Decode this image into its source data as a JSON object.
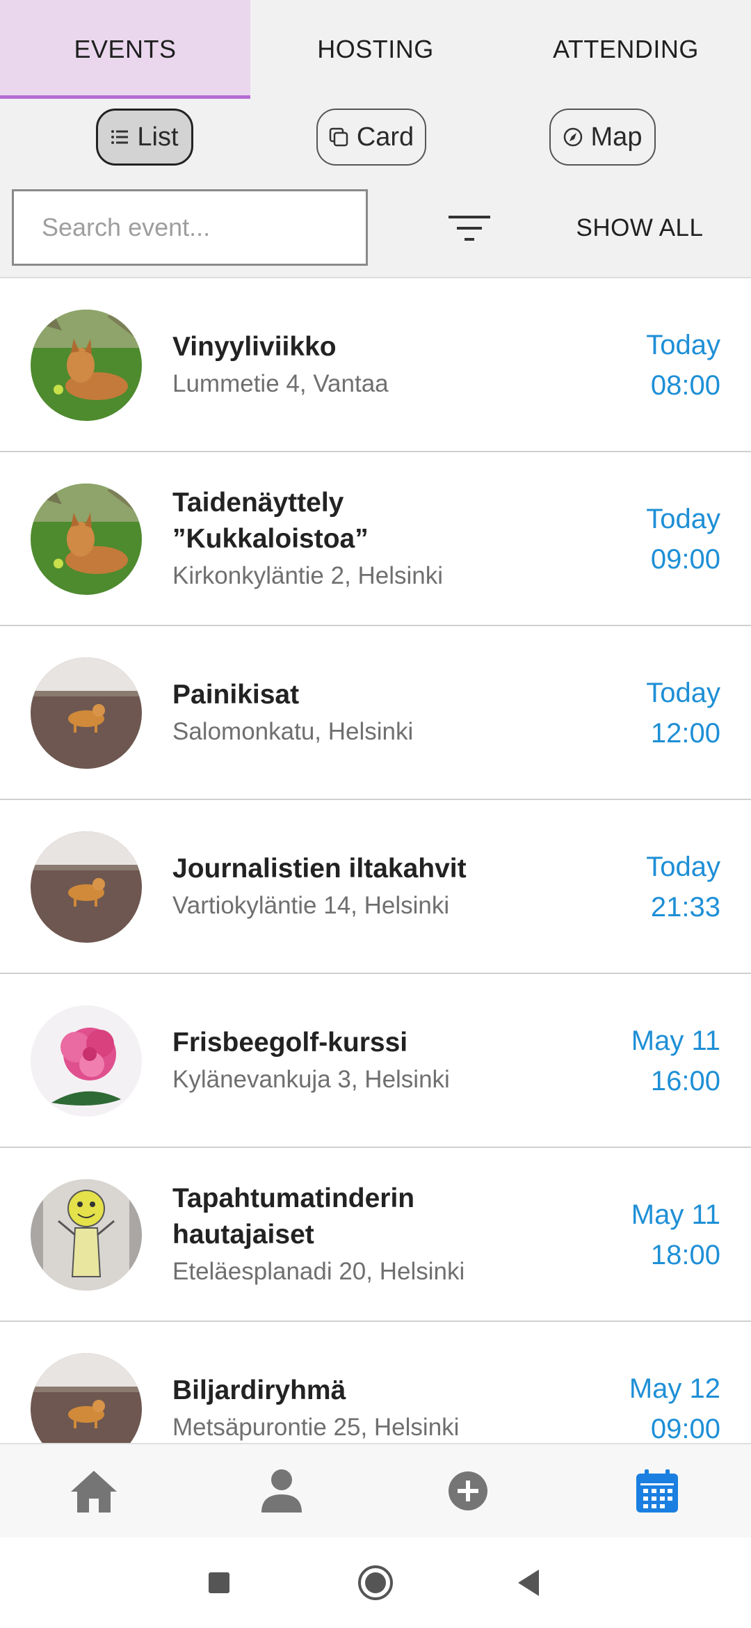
{
  "tabs": [
    {
      "label": "EVENTS",
      "active": true
    },
    {
      "label": "HOSTING",
      "active": false
    },
    {
      "label": "ATTENDING",
      "active": false
    }
  ],
  "view_toggles": [
    {
      "label": "List",
      "icon": "list-icon",
      "selected": true
    },
    {
      "label": "Card",
      "icon": "card-icon",
      "selected": false
    },
    {
      "label": "Map",
      "icon": "map-icon",
      "selected": false
    }
  ],
  "search": {
    "placeholder": "Search event...",
    "value": ""
  },
  "filter": {
    "icon": "filter-icon"
  },
  "show_all_label": "SHOW ALL",
  "events": [
    {
      "title": "Vinyyliviikko",
      "address": "Lummetie 4, Vantaa",
      "day": "Today",
      "time": "08:00",
      "image": "dog-on-grass"
    },
    {
      "title": "Taidenäyttely ”Kukkaloistoa”",
      "address": "Kirkonkyläntie 2, Helsinki",
      "day": "Today",
      "time": "09:00",
      "image": "dog-on-grass"
    },
    {
      "title": "Painikisat",
      "address": "Salomonkatu, Helsinki",
      "day": "Today",
      "time": "12:00",
      "image": "dog-in-field"
    },
    {
      "title": "Journalistien iltakahvit",
      "address": "Vartiokyläntie 14, Helsinki",
      "day": "Today",
      "time": "21:33",
      "image": "dog-in-field"
    },
    {
      "title": "Frisbeegolf-kurssi",
      "address": "Kylänevankuja 3, Helsinki",
      "day": "May 11",
      "time": "16:00",
      "image": "pink-flower"
    },
    {
      "title": "Tapahtumatinderin hautajaiset",
      "address": "Eteläesplanadi 20, Helsinki",
      "day": "May 11",
      "time": "18:00",
      "image": "drawing"
    },
    {
      "title": "Biljardiryhmä",
      "address": "Metsäpurontie 25, Helsinki",
      "day": "May 12",
      "time": "09:00",
      "image": "dog-in-field"
    }
  ],
  "bottom_nav": [
    {
      "icon": "home-icon",
      "active": false
    },
    {
      "icon": "profile-icon",
      "active": false
    },
    {
      "icon": "add-icon",
      "active": false
    },
    {
      "icon": "calendar-icon",
      "active": true
    }
  ],
  "colors": {
    "accent_tab": "#b56cd2",
    "active_tab_bg": "#ead7ee",
    "date_text": "#1e8fd6",
    "active_nav": "#1a7fe0",
    "inactive_nav": "#757575"
  }
}
